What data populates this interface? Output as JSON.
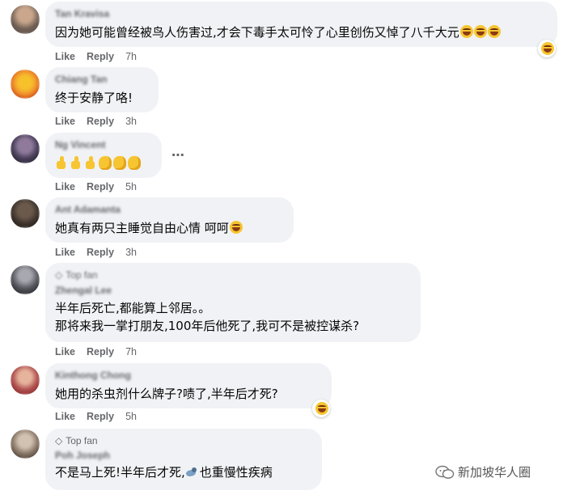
{
  "comments": [
    {
      "name": "Tan Kravisa",
      "badge": "",
      "lines": [
        "因为她可能曾经被鸟人伤害过,才会下毒手太可怜了心里创伤又悼了八千大元"
      ],
      "like": "Like",
      "reply": "Reply",
      "time": "7h",
      "avatar_colors": [
        "#c9a68c",
        "#6b5b52"
      ]
    },
    {
      "name": "Chiang Tan",
      "badge": "",
      "lines": [
        "终于安静了咯!"
      ],
      "like": "Like",
      "reply": "Reply",
      "time": "3h",
      "avatar_colors": [
        "#f39a2e",
        "#d4551a"
      ]
    },
    {
      "name": "Ng Vincent",
      "badge": "",
      "lines": [
        ""
      ],
      "like": "Like",
      "reply": "Reply",
      "time": "5h",
      "avatar_colors": [
        "#7f6a8c",
        "#2f2a3a"
      ]
    },
    {
      "name": "Ant Adamanta",
      "badge": "",
      "lines": [
        "她真有两只主睡觉自由心情  呵呵"
      ],
      "like": "Like",
      "reply": "Reply",
      "time": "3h",
      "avatar_colors": [
        "#5a4a3e",
        "#2c2420"
      ]
    },
    {
      "name": "Zhengal Lee",
      "badge": "Top fan",
      "lines": [
        "半年后死亡,都能算上邻居。。",
        "那将来我一掌打朋友,100年后他死了,我可不是被控谋杀?"
      ],
      "like": "Like",
      "reply": "Reply",
      "time": "7h",
      "avatar_colors": [
        "#8c8c94",
        "#2a2a30"
      ]
    },
    {
      "name": "Kinthong Chong",
      "badge": "",
      "lines": [
        "她用的杀虫剂什么牌子?啧了,半年后才死?"
      ],
      "like": "Like",
      "reply": "Reply",
      "time": "5h",
      "avatar_colors": [
        "#d9a08a",
        "#8a2a2a"
      ]
    },
    {
      "name": "Poh Joseph",
      "badge": "Top fan",
      "lines_before": "不是马上死!半年后才死,",
      "lines_after": "也重慢性疾病",
      "like": "",
      "reply": "",
      "time": "",
      "avatar_colors": [
        "#b8a898",
        "#4a3e36"
      ]
    }
  ],
  "more_icon": "⋯",
  "watermark": "新加坡华人圈"
}
